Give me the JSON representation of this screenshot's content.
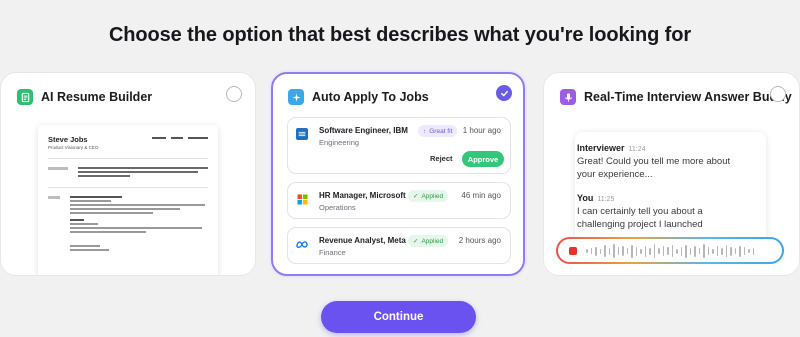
{
  "headline": "Choose the option that best describes what you're looking for",
  "colors": {
    "accent": "#6a52f0",
    "selected_border": "#8c7ef2",
    "approve": "#34c77b",
    "record": "#e5322c"
  },
  "options": [
    {
      "title": "AI Resume Builder",
      "icon": "document-icon",
      "selected": false,
      "resume": {
        "name": "Steve Jobs",
        "role": "Product Visionary & CEO"
      }
    },
    {
      "title": "Auto Apply To Jobs",
      "icon": "sparkle-icon",
      "selected": true,
      "jobs": [
        {
          "title": "Software Engineer, IBM",
          "department": "Engineering",
          "status": "Great fit",
          "time": "1 hour ago",
          "reject": "Reject",
          "approve": "Approve"
        },
        {
          "title": "HR Manager, Microsoft",
          "department": "Operations",
          "status": "Applied",
          "time": "46 min ago"
        },
        {
          "title": "Revenue Analyst, Meta",
          "department": "Finance",
          "status": "Applied",
          "time": "2 hours ago"
        }
      ]
    },
    {
      "title": "Real-Time Interview Answer Buddy",
      "icon": "microphone-icon",
      "selected": false,
      "chat": [
        {
          "speaker": "Interviewer",
          "time": "11:24",
          "text": "Great! Could you tell me more about your experience..."
        },
        {
          "speaker": "You",
          "time": "11:25",
          "text": "I can certainly tell you about a challenging project I launched"
        }
      ]
    }
  ],
  "continue_label": "Continue"
}
